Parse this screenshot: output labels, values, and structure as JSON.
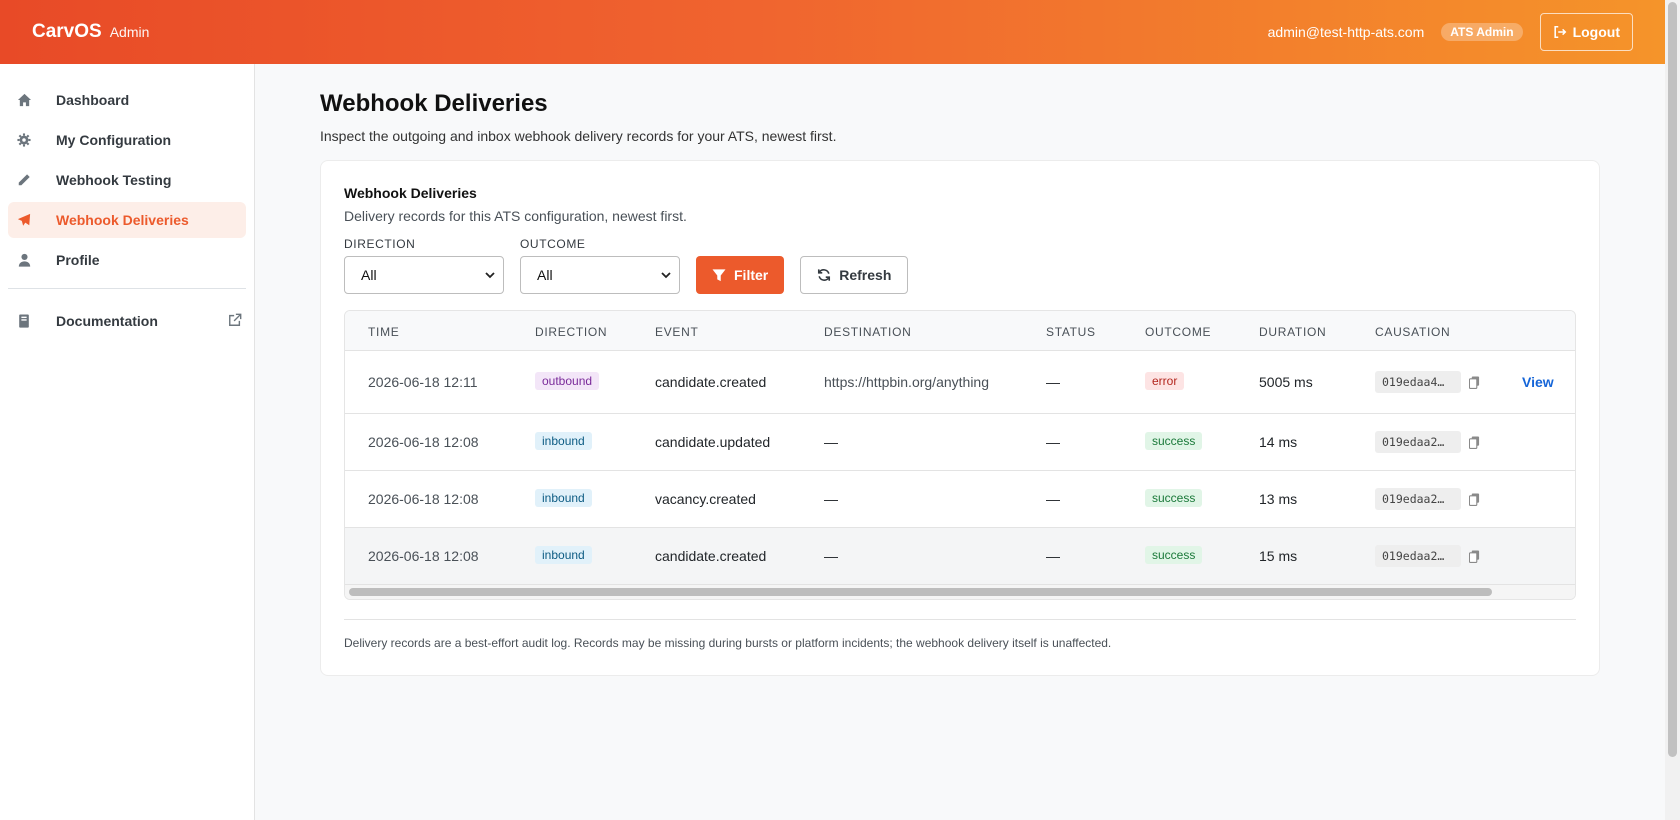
{
  "header": {
    "brand": "CarvOS",
    "brand_sub": "Admin",
    "user_email": "admin@test-http-ats.com",
    "role_badge": "ATS Admin",
    "logout_label": "Logout"
  },
  "sidebar": {
    "items": [
      {
        "label": "Dashboard",
        "icon": "home-icon",
        "active": false
      },
      {
        "label": "My Configuration",
        "icon": "gear-icon",
        "active": false
      },
      {
        "label": "Webhook Testing",
        "icon": "pencil-icon",
        "active": false
      },
      {
        "label": "Webhook Deliveries",
        "icon": "paper-plane-icon",
        "active": true
      },
      {
        "label": "Profile",
        "icon": "user-icon",
        "active": false
      }
    ],
    "docs": {
      "label": "Documentation",
      "icon": "book-icon",
      "ext_icon": "external-link-icon"
    }
  },
  "page": {
    "title": "Webhook Deliveries",
    "subtitle": "Inspect the outgoing and inbox webhook delivery records for your ATS, newest first."
  },
  "card": {
    "title": "Webhook Deliveries",
    "subtitle": "Delivery records for this ATS configuration, newest first.",
    "filters": {
      "direction_label": "DIRECTION",
      "direction_value": "All",
      "outcome_label": "OUTCOME",
      "outcome_value": "All",
      "filter_button": "Filter",
      "refresh_button": "Refresh"
    },
    "table": {
      "columns": [
        "TIME",
        "DIRECTION",
        "EVENT",
        "DESTINATION",
        "STATUS",
        "OUTCOME",
        "DURATION",
        "CAUSATION"
      ],
      "rows": [
        {
          "time": "2026-06-18 12:11",
          "direction": "outbound",
          "event": "candidate.created",
          "destination": "https://httpbin.org/anything",
          "status": "—",
          "outcome": "error",
          "duration": "5005 ms",
          "causation": "019edaa4…",
          "action": "View"
        },
        {
          "time": "2026-06-18 12:08",
          "direction": "inbound",
          "event": "candidate.updated",
          "destination": "—",
          "status": "—",
          "outcome": "success",
          "duration": "14 ms",
          "causation": "019edaa2…",
          "action": ""
        },
        {
          "time": "2026-06-18 12:08",
          "direction": "inbound",
          "event": "vacancy.created",
          "destination": "—",
          "status": "—",
          "outcome": "success",
          "duration": "13 ms",
          "causation": "019edaa2…",
          "action": ""
        },
        {
          "time": "2026-06-18 12:08",
          "direction": "inbound",
          "event": "candidate.created",
          "destination": "—",
          "status": "—",
          "outcome": "success",
          "duration": "15 ms",
          "causation": "019edaa2…",
          "action": ""
        }
      ]
    },
    "footnote": "Delivery records are a best-effort audit log. Records may be missing during bursts or platform incidents; the webhook delivery itself is unaffected."
  },
  "colors": {
    "accent": "#ec5a2c",
    "link": "#1565d8",
    "header_gradient_start": "#e84a27",
    "header_gradient_end": "#f5942a"
  }
}
